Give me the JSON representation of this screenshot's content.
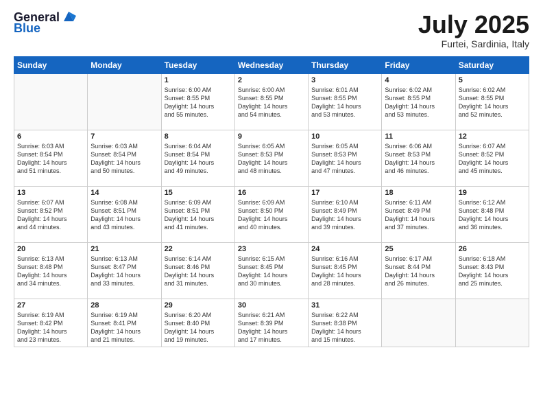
{
  "logo": {
    "line1": "General",
    "line2": "Blue"
  },
  "title": "July 2025",
  "subtitle": "Furtei, Sardinia, Italy",
  "weekdays": [
    "Sunday",
    "Monday",
    "Tuesday",
    "Wednesday",
    "Thursday",
    "Friday",
    "Saturday"
  ],
  "weeks": [
    [
      {
        "day": "",
        "info": ""
      },
      {
        "day": "",
        "info": ""
      },
      {
        "day": "1",
        "info": "Sunrise: 6:00 AM\nSunset: 8:55 PM\nDaylight: 14 hours\nand 55 minutes."
      },
      {
        "day": "2",
        "info": "Sunrise: 6:00 AM\nSunset: 8:55 PM\nDaylight: 14 hours\nand 54 minutes."
      },
      {
        "day": "3",
        "info": "Sunrise: 6:01 AM\nSunset: 8:55 PM\nDaylight: 14 hours\nand 53 minutes."
      },
      {
        "day": "4",
        "info": "Sunrise: 6:02 AM\nSunset: 8:55 PM\nDaylight: 14 hours\nand 53 minutes."
      },
      {
        "day": "5",
        "info": "Sunrise: 6:02 AM\nSunset: 8:55 PM\nDaylight: 14 hours\nand 52 minutes."
      }
    ],
    [
      {
        "day": "6",
        "info": "Sunrise: 6:03 AM\nSunset: 8:54 PM\nDaylight: 14 hours\nand 51 minutes."
      },
      {
        "day": "7",
        "info": "Sunrise: 6:03 AM\nSunset: 8:54 PM\nDaylight: 14 hours\nand 50 minutes."
      },
      {
        "day": "8",
        "info": "Sunrise: 6:04 AM\nSunset: 8:54 PM\nDaylight: 14 hours\nand 49 minutes."
      },
      {
        "day": "9",
        "info": "Sunrise: 6:05 AM\nSunset: 8:53 PM\nDaylight: 14 hours\nand 48 minutes."
      },
      {
        "day": "10",
        "info": "Sunrise: 6:05 AM\nSunset: 8:53 PM\nDaylight: 14 hours\nand 47 minutes."
      },
      {
        "day": "11",
        "info": "Sunrise: 6:06 AM\nSunset: 8:53 PM\nDaylight: 14 hours\nand 46 minutes."
      },
      {
        "day": "12",
        "info": "Sunrise: 6:07 AM\nSunset: 8:52 PM\nDaylight: 14 hours\nand 45 minutes."
      }
    ],
    [
      {
        "day": "13",
        "info": "Sunrise: 6:07 AM\nSunset: 8:52 PM\nDaylight: 14 hours\nand 44 minutes."
      },
      {
        "day": "14",
        "info": "Sunrise: 6:08 AM\nSunset: 8:51 PM\nDaylight: 14 hours\nand 43 minutes."
      },
      {
        "day": "15",
        "info": "Sunrise: 6:09 AM\nSunset: 8:51 PM\nDaylight: 14 hours\nand 41 minutes."
      },
      {
        "day": "16",
        "info": "Sunrise: 6:09 AM\nSunset: 8:50 PM\nDaylight: 14 hours\nand 40 minutes."
      },
      {
        "day": "17",
        "info": "Sunrise: 6:10 AM\nSunset: 8:49 PM\nDaylight: 14 hours\nand 39 minutes."
      },
      {
        "day": "18",
        "info": "Sunrise: 6:11 AM\nSunset: 8:49 PM\nDaylight: 14 hours\nand 37 minutes."
      },
      {
        "day": "19",
        "info": "Sunrise: 6:12 AM\nSunset: 8:48 PM\nDaylight: 14 hours\nand 36 minutes."
      }
    ],
    [
      {
        "day": "20",
        "info": "Sunrise: 6:13 AM\nSunset: 8:48 PM\nDaylight: 14 hours\nand 34 minutes."
      },
      {
        "day": "21",
        "info": "Sunrise: 6:13 AM\nSunset: 8:47 PM\nDaylight: 14 hours\nand 33 minutes."
      },
      {
        "day": "22",
        "info": "Sunrise: 6:14 AM\nSunset: 8:46 PM\nDaylight: 14 hours\nand 31 minutes."
      },
      {
        "day": "23",
        "info": "Sunrise: 6:15 AM\nSunset: 8:45 PM\nDaylight: 14 hours\nand 30 minutes."
      },
      {
        "day": "24",
        "info": "Sunrise: 6:16 AM\nSunset: 8:45 PM\nDaylight: 14 hours\nand 28 minutes."
      },
      {
        "day": "25",
        "info": "Sunrise: 6:17 AM\nSunset: 8:44 PM\nDaylight: 14 hours\nand 26 minutes."
      },
      {
        "day": "26",
        "info": "Sunrise: 6:18 AM\nSunset: 8:43 PM\nDaylight: 14 hours\nand 25 minutes."
      }
    ],
    [
      {
        "day": "27",
        "info": "Sunrise: 6:19 AM\nSunset: 8:42 PM\nDaylight: 14 hours\nand 23 minutes."
      },
      {
        "day": "28",
        "info": "Sunrise: 6:19 AM\nSunset: 8:41 PM\nDaylight: 14 hours\nand 21 minutes."
      },
      {
        "day": "29",
        "info": "Sunrise: 6:20 AM\nSunset: 8:40 PM\nDaylight: 14 hours\nand 19 minutes."
      },
      {
        "day": "30",
        "info": "Sunrise: 6:21 AM\nSunset: 8:39 PM\nDaylight: 14 hours\nand 17 minutes."
      },
      {
        "day": "31",
        "info": "Sunrise: 6:22 AM\nSunset: 8:38 PM\nDaylight: 14 hours\nand 15 minutes."
      },
      {
        "day": "",
        "info": ""
      },
      {
        "day": "",
        "info": ""
      }
    ]
  ]
}
